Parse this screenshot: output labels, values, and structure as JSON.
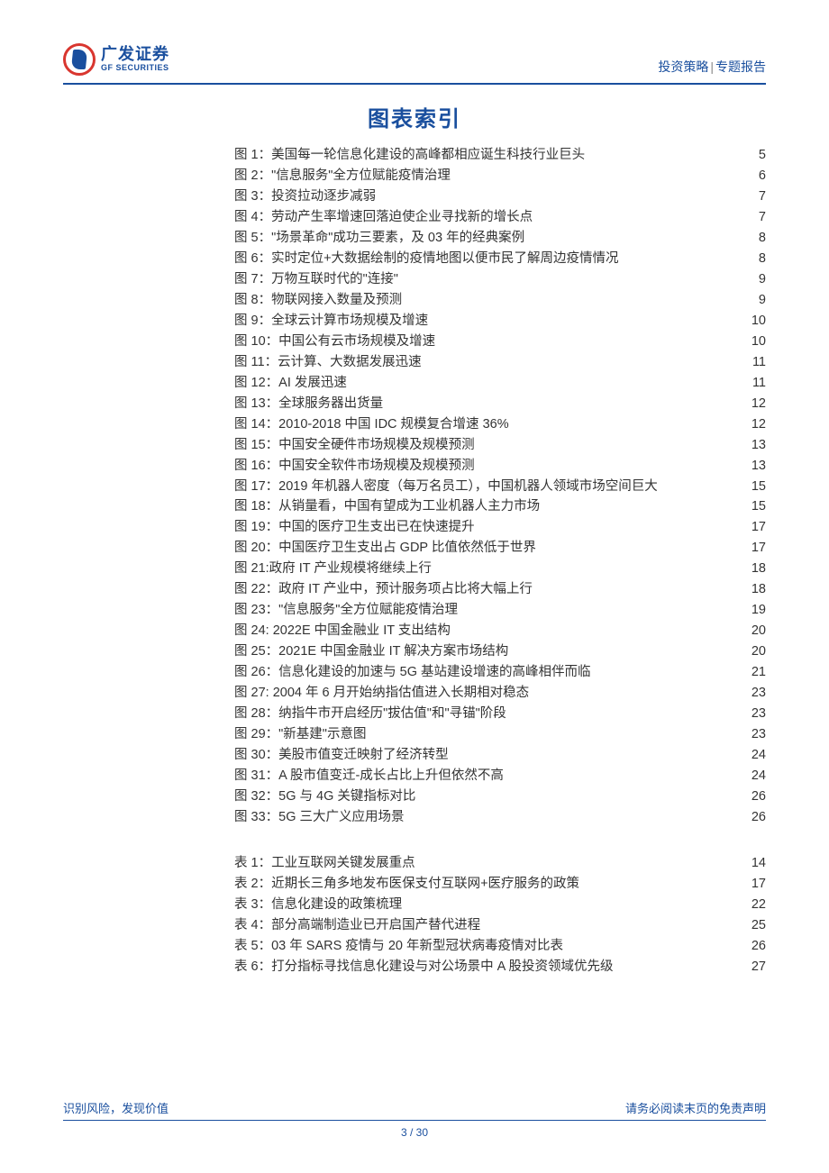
{
  "header": {
    "logo_cn": "广发证券",
    "logo_en": "GF SECURITIES",
    "category": "投资策略",
    "divider": "|",
    "subcategory": "专题报告"
  },
  "title": "图表索引",
  "figures": [
    {
      "label": "图 1：美国每一轮信息化建设的高峰都相应诞生科技行业巨头",
      "page": "5"
    },
    {
      "label": "图 2：\"信息服务\"全方位赋能疫情治理",
      "page": "6"
    },
    {
      "label": "图 3：投资拉动逐步减弱",
      "page": "7"
    },
    {
      "label": "图 4：劳动产生率增速回落迫使企业寻找新的增长点",
      "page": "7"
    },
    {
      "label": "图 5：\"场景革命\"成功三要素，及 03 年的经典案例",
      "page": "8"
    },
    {
      "label": "图 6：实时定位+大数据绘制的疫情地图以便市民了解周边疫情情况",
      "page": "8"
    },
    {
      "label": "图 7：万物互联时代的\"连接\"",
      "page": "9"
    },
    {
      "label": "图 8：物联网接入数量及预测",
      "page": "9"
    },
    {
      "label": "图 9：全球云计算市场规模及增速",
      "page": "10"
    },
    {
      "label": "图 10：中国公有云市场规模及增速",
      "page": "10"
    },
    {
      "label": "图 11：云计算、大数据发展迅速",
      "page": "11"
    },
    {
      "label": "图 12：AI 发展迅速",
      "page": "11"
    },
    {
      "label": "图 13：全球服务器出货量",
      "page": "12"
    },
    {
      "label": "图 14：2010-2018 中国 IDC 规模复合增速 36%",
      "page": "12"
    },
    {
      "label": "图 15：中国安全硬件市场规模及规模预测",
      "page": "13"
    },
    {
      "label": "图 16：中国安全软件市场规模及规模预测",
      "page": "13"
    },
    {
      "label": "图 17：2019 年机器人密度（每万名员工），中国机器人领域市场空间巨大",
      "page": "15"
    },
    {
      "label": "图 18：从销量看，中国有望成为工业机器人主力市场",
      "page": "15"
    },
    {
      "label": "图 19：中国的医疗卫生支出已在快速提升",
      "page": "17"
    },
    {
      "label": "图 20：中国医疗卫生支出占 GDP 比值依然低于世界",
      "page": "17"
    },
    {
      "label": "图 21:政府 IT 产业规模将继续上行",
      "page": "18"
    },
    {
      "label": "图 22：政府 IT 产业中，预计服务项占比将大幅上行",
      "page": "18"
    },
    {
      "label": "图 23：\"信息服务\"全方位赋能疫情治理",
      "page": "19"
    },
    {
      "label": "图 24: 2022E 中国金融业 IT 支出结构",
      "page": "20"
    },
    {
      "label": "图 25：2021E 中国金融业 IT 解决方案市场结构",
      "page": "20"
    },
    {
      "label": "图 26：信息化建设的加速与 5G 基站建设增速的高峰相伴而临",
      "page": "21"
    },
    {
      "label": "图 27: 2004 年 6 月开始纳指估值进入长期相对稳态",
      "page": "23"
    },
    {
      "label": "图 28：纳指牛市开启经历\"拔估值\"和\"寻锚\"阶段",
      "page": "23"
    },
    {
      "label": "图 29：\"新基建\"示意图",
      "page": "23"
    },
    {
      "label": "图 30：美股市值变迁映射了经济转型",
      "page": "24"
    },
    {
      "label": "图 31：A 股市值变迁-成长占比上升但依然不高",
      "page": "24"
    },
    {
      "label": "图 32：5G 与 4G 关键指标对比",
      "page": "26"
    },
    {
      "label": "图 33：5G 三大广义应用场景",
      "page": "26"
    }
  ],
  "tables": [
    {
      "label": "表 1：工业互联网关键发展重点",
      "page": "14"
    },
    {
      "label": "表 2：近期长三角多地发布医保支付互联网+医疗服务的政策",
      "page": "17"
    },
    {
      "label": "表 3：信息化建设的政策梳理",
      "page": "22"
    },
    {
      "label": "表 4：部分高端制造业已开启国产替代进程",
      "page": "25"
    },
    {
      "label": "表 5：03 年 SARS 疫情与 20 年新型冠状病毒疫情对比表",
      "page": "26"
    },
    {
      "label": "表 6：打分指标寻找信息化建设与对公场景中 A 股投资领域优先级",
      "page": "27"
    }
  ],
  "footer": {
    "left": "识别风险，发现价值",
    "right": "请务必阅读末页的免责声明",
    "pager_current": "3",
    "pager_sep": " / ",
    "pager_total": "30"
  }
}
